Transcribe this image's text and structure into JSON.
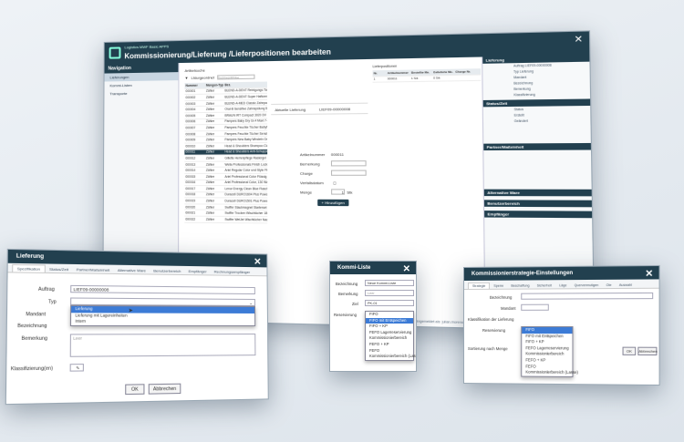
{
  "main": {
    "app_name": "Logistics MWF Basic APPS",
    "title": "Kommissionierung/Lieferung /Lieferpositionen bearbeiten",
    "nav_header": "Navigation",
    "nav_items": [
      "Lieferungen",
      "Kommi-Listen",
      "Transporte"
    ],
    "list_label": "Artikelsuche",
    "filter_label": "Lfdurgeordnet",
    "filter_placeholder": "Suchbegriff/Filter",
    "columns": [
      "Nummer",
      "Mengen-Typ",
      "Bez."
    ],
    "rows": [
      [
        "000001",
        "Zähler",
        "BLEND-A-DENT Reinigungs-Tabs langan"
      ],
      [
        "000002",
        "Zähler",
        "BLEND-A-DENT Super Haftcreme Neutral"
      ],
      [
        "000003",
        "Zähler",
        "BLEND-A-MED Classic Zahnpasta"
      ],
      [
        "000004",
        "Zähler",
        "Oral-B Sensitive Zahnspülung 500ml"
      ],
      [
        "000005",
        "Zähler",
        "BRAUN IRT Compact 3020 DV"
      ],
      [
        "000006",
        "Zähler",
        "Pampers Baby Dry Gr.4 Maxi 7-18kg"
      ],
      [
        "000007",
        "Zähler",
        "Pampers Feuchte Tücher Babyfresh"
      ],
      [
        "000008",
        "Zähler",
        "Pampers Feuchte Tücher Sensitive Nach"
      ],
      [
        "000009",
        "Zähler",
        "Pampers New Baby Windeln Gr.1 Newborn"
      ],
      [
        "000010",
        "Zähler",
        "Head & Shoulders Shampoo Classic Clean"
      ],
      [
        "000011",
        "Zähler",
        "Head & Shoulders Anti-Schuppen Shampoo"
      ],
      [
        "000012",
        "Zähler",
        "Gillette Herrenpflege Rasiergel"
      ],
      [
        "000013",
        "Zähler",
        "Wella Professionals Finish Locken"
      ],
      [
        "000014",
        "Zähler",
        "Ariel Regular Color und Style Flüssigwasch"
      ],
      [
        "000015",
        "Zähler",
        "Ariel Professional Color Flüssig"
      ],
      [
        "000016",
        "Zähler",
        "Ariel Professional Color, 130 Waschladungen"
      ],
      [
        "000017",
        "Zähler",
        "Lenor Energy Clean Blue Flasche, 3xl"
      ],
      [
        "000018",
        "Zähler",
        "Duracell DURO1604 Plus Power 9V"
      ],
      [
        "000019",
        "Zähler",
        "Duracell DURO1501 Plus Power 1.5V"
      ],
      [
        "000020",
        "Zähler",
        "Swiffer Staubmagnet Starterset"
      ],
      [
        "000021",
        "Zähler",
        "Swiffer Trocken Wischtücher 18er"
      ],
      [
        "000022",
        "Zähler",
        "Swiffer WetJet Wischtücher Nachfüllpack"
      ]
    ],
    "selected_row": 10,
    "current_delivery_label": "Aktuelle Lieferung",
    "current_delivery_value": "LIEF09-00000008",
    "article_no_label": "Artikelnummer",
    "article_no_value": "000011",
    "note_label": "Bemerkung",
    "batch_label": "Charge",
    "expiry_label": "Verfallsdatum",
    "qty_label": "Menge",
    "qty_value": "1",
    "qty_unit": "Stk",
    "add_button": "Hinzufügen",
    "positions_label": "Lieferpositionen",
    "pos_columns": [
      "Nr.",
      "Artikelnummer",
      "Bestellte Me.",
      "Gelieferte Me.",
      "Charge Nr."
    ],
    "pos_row": [
      "1",
      "000011",
      "1 Stk",
      "0 Stk",
      ""
    ],
    "side_sections": [
      "Lieferung",
      "Status/Zeit",
      "Partner/Maßeinheit",
      "Alternative Ware",
      "Benutzerbereich",
      "Empfänger"
    ],
    "side_labels": [
      "Auftrag",
      "Typ",
      "Mandant",
      "Bezeichnung",
      "Bemerkung",
      "Klassifizierung",
      "Status",
      "Erstellt",
      "Geändert"
    ],
    "side_values": [
      "LIEF09-00000008",
      "Lieferung"
    ],
    "footer": "Angemeldet als: julian.moreno@ait-dev.de"
  },
  "lieferung": {
    "title": "Lieferung",
    "tabs": [
      "Spezifikation",
      "Status/Zeit",
      "Partner/Maßeinheit",
      "Alternative Ware",
      "Benutzerbereich",
      "Empfänger",
      "Rechnungsempfänger"
    ],
    "auftrag_label": "Auftrag",
    "auftrag_value": "LIEF09-00000008",
    "typ_label": "Typ",
    "mandant_label": "Mandant",
    "bezeichnung_label": "Bezeichnung",
    "bemerkung_label": "Bemerkung",
    "bemerkung_placeholder": "Leer",
    "klass_label": "Klassifizierung(en)",
    "typ_options": [
      "Lieferung",
      "Lieferung mit Lagereinheiten",
      "Intern"
    ],
    "ok": "OK",
    "cancel": "Abbrechen"
  },
  "kommi": {
    "title": "Kommi-Liste",
    "bez_label": "Bezeichnung",
    "bez_value": "Neue Kommi-Liste",
    "bem_label": "Bemerkung",
    "bem_value": "Leer",
    "ziel_label": "Ziel",
    "ziel_value": "PK-01",
    "res_label": "Reservierung",
    "options": [
      "FIFO",
      "FIFO mit Entspeichen",
      "FIFO + KP",
      "FEFO Lagerreservierung",
      "Kommissionierbereich",
      "FEFO + KP",
      "FEFO",
      "Kommissionierbereich (Lasse)"
    ],
    "selected": 1
  },
  "strat": {
    "title": "Kommissionierstrategie-Einstellungen",
    "tabs": [
      "Strategie",
      "Sperre",
      "Beschaffung",
      "Sicherheit",
      "Läge",
      "Quervermutigen",
      "Ole",
      "Auswahl"
    ],
    "bez_label": "Bezeichnung",
    "mandant_label": "Mandant",
    "klass_label": "Klassifikation der Lieferung",
    "res_label": "Reservierung",
    "sort_label": "Sortierung nach Menge",
    "options": [
      "FIFO",
      "FIFO mit Entspeichen",
      "FIFO + KP",
      "FEFO Lagerreservierung",
      "Kommissionierbereich",
      "FEFO + KP",
      "FEFO",
      "Kommissionierbereich (Lasse)"
    ],
    "selected": 0,
    "ok": "OK",
    "cancel": "Abbrechen"
  }
}
